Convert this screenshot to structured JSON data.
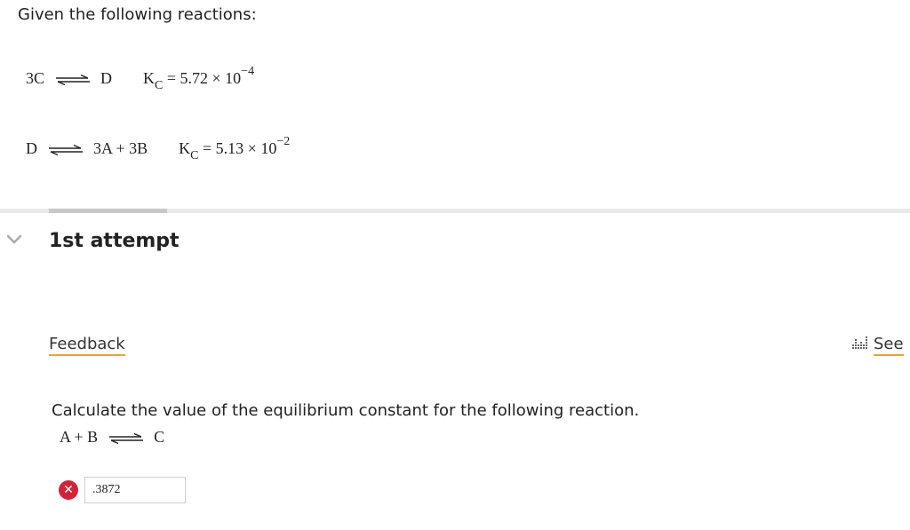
{
  "intro": "Given the following reactions:",
  "reaction1": {
    "reactant": "3C",
    "product": "D",
    "k_symbol": "K",
    "k_subscript": "C",
    "k_value": "= 5.72 × 10",
    "k_exponent": "−4"
  },
  "reaction2": {
    "reactant": "D",
    "product": "3A + 3B",
    "k_symbol": "K",
    "k_subscript": "C",
    "k_value": "= 5.13 × 10",
    "k_exponent": "−2"
  },
  "attempt_heading": "1st attempt",
  "feedback_label": "Feedback",
  "see_label": "See",
  "question": "Calculate the value of the equilibrium constant for the following reaction.",
  "target_reaction": {
    "reactant": "A + B",
    "product": "C"
  },
  "answer": {
    "value": ".3872",
    "status": "incorrect"
  },
  "colors": {
    "error": "#d1243b",
    "accent_underline": "#e0a92c",
    "chevron": "#aaaaaa"
  },
  "icons": {
    "chevron": "chevron-down-icon",
    "error": "error-x-icon",
    "see": "bar-chart-icon",
    "arrow": "equilibrium-arrow-icon"
  }
}
